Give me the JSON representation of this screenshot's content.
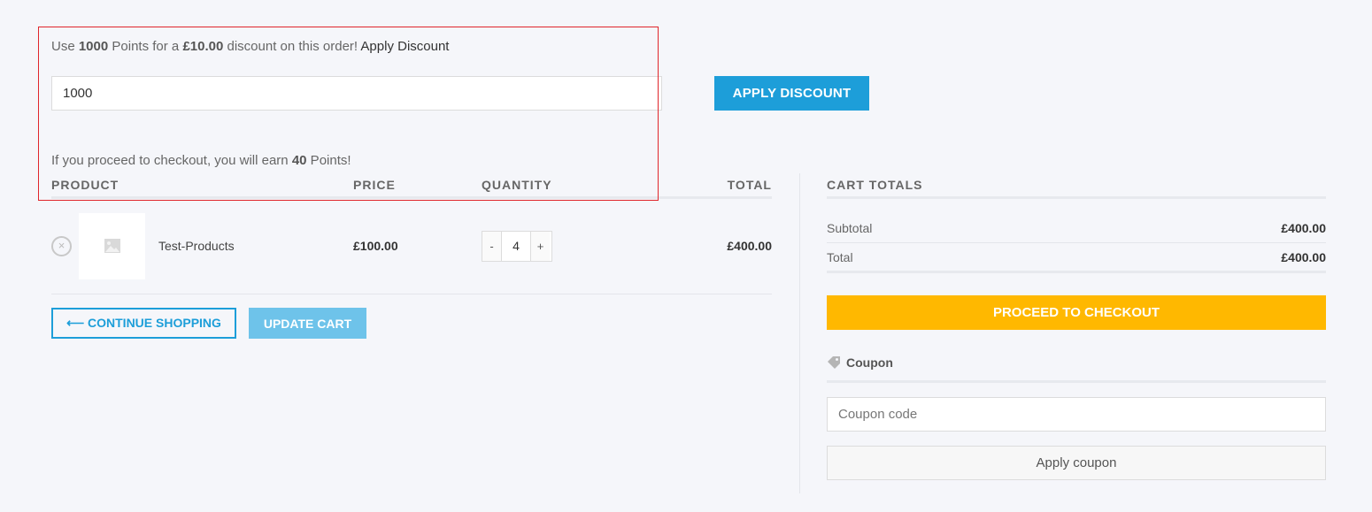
{
  "points": {
    "message": {
      "prefix": "Use ",
      "points": "1000",
      "mid1": " Points for a ",
      "amount": "£10.00",
      "mid2": " discount on this order! ",
      "link": "Apply Discount"
    },
    "input_value": "1000",
    "apply_button": "APPLY DISCOUNT",
    "earn": {
      "prefix": "If you proceed to checkout, you will earn ",
      "points": "40",
      "suffix": " Points!"
    }
  },
  "cart": {
    "headers": {
      "product": "PRODUCT",
      "price": "PRICE",
      "quantity": "QUANTITY",
      "total": "TOTAL"
    },
    "items": [
      {
        "remove_icon": "×",
        "name": "Test-Products",
        "price": "£100.00",
        "quantity": "4",
        "decrement": "-",
        "increment": "+",
        "total": "£400.00"
      }
    ],
    "continue_button": "⟵ CONTINUE SHOPPING",
    "update_button": "UPDATE CART"
  },
  "totals": {
    "title": "CART TOTALS",
    "subtotal_label": "Subtotal",
    "subtotal_value": "£400.00",
    "total_label": "Total",
    "total_value": "£400.00",
    "checkout_button": "PROCEED TO CHECKOUT",
    "coupon_label": "Coupon",
    "coupon_placeholder": "Coupon code",
    "apply_coupon_button": "Apply coupon"
  },
  "colors": {
    "accent": "#1d9ed9",
    "checkout": "#ffb800",
    "highlight_border": "#e0262b"
  },
  "icons": [
    "remove-item-icon",
    "image-placeholder-icon",
    "tag-icon",
    "arrow-left-icon"
  ]
}
